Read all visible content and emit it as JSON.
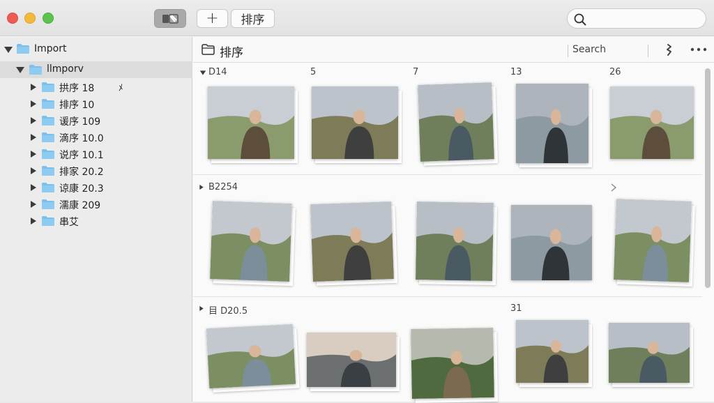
{
  "toolbar": {
    "add_label": "+",
    "sort_label": "排序"
  },
  "sidebar": {
    "root": {
      "label": "Import"
    },
    "selected": {
      "label": "llmporv"
    },
    "items": [
      {
        "label": "拱序 18",
        "badge": "ﾒ"
      },
      {
        "label": "排序 10"
      },
      {
        "label": "谖序 109"
      },
      {
        "label": "滴序 10.0"
      },
      {
        "label": "说序 10.1"
      },
      {
        "label": "排家 20.2"
      },
      {
        "label": "谅康 20.3"
      },
      {
        "label": "濡康 209"
      },
      {
        "label": "串艾"
      }
    ]
  },
  "main": {
    "title": "排序",
    "search_placeholder": "Search",
    "sections": [
      {
        "label": "D14",
        "col_labels": [
          "5",
          "7",
          "13",
          "26"
        ]
      },
      {
        "label": "B2254",
        "col_labels": []
      },
      {
        "label": "目 D20.5",
        "col_labels": [
          "31"
        ]
      }
    ]
  },
  "colors": {
    "close": "#ee5b55",
    "minimize": "#f4b93a",
    "zoom": "#5cc44d",
    "folder": "#7cc0ea"
  }
}
